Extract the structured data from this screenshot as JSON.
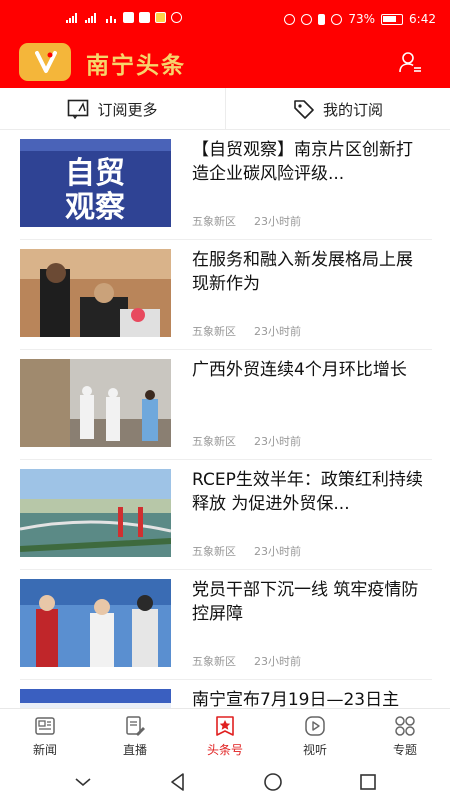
{
  "status_bar": {
    "battery_percent": "73%",
    "time": "6:42"
  },
  "header": {
    "app_title": "南宁头条",
    "logo_icon": "logo-icon",
    "user_icon": "user-list-icon",
    "brand_color": "#ff0000",
    "title_color": "#f7d46b"
  },
  "sub_tabs": [
    {
      "label": "订阅更多",
      "icon": "picture-frame-icon"
    },
    {
      "label": "我的订阅",
      "icon": "tag-icon"
    }
  ],
  "news": [
    {
      "title": "【自贸观察】南京片区创新打造企业碳风险评级...",
      "source": "五象新区",
      "time": "23小时前",
      "thumb_text": [
        "自贸",
        "观察"
      ]
    },
    {
      "title": "在服务和融入新发展格局上展现新作为",
      "source": "五象新区",
      "time": "23小时前"
    },
    {
      "title": "广西外贸连续4个月环比增长",
      "source": "五象新区",
      "time": "23小时前"
    },
    {
      "title": "RCEP生效半年：政策红利持续释放 为促进外贸保...",
      "source": "五象新区",
      "time": "23小时前"
    },
    {
      "title": "党员干部下沉一线 筑牢疫情防控屏障",
      "source": "五象新区",
      "time": "23小时前"
    },
    {
      "title": "南宁宣布7月19日—23日主",
      "source": "",
      "time": ""
    }
  ],
  "bottom_nav": [
    {
      "label": "新闻",
      "icon": "newspaper-icon",
      "active": false
    },
    {
      "label": "直播",
      "icon": "document-edit-icon",
      "active": false
    },
    {
      "label": "头条号",
      "icon": "star-badge-icon",
      "active": true
    },
    {
      "label": "视听",
      "icon": "play-circle-icon",
      "active": false
    },
    {
      "label": "专题",
      "icon": "grid-circles-icon",
      "active": false
    }
  ],
  "accent_color": "#e02020"
}
